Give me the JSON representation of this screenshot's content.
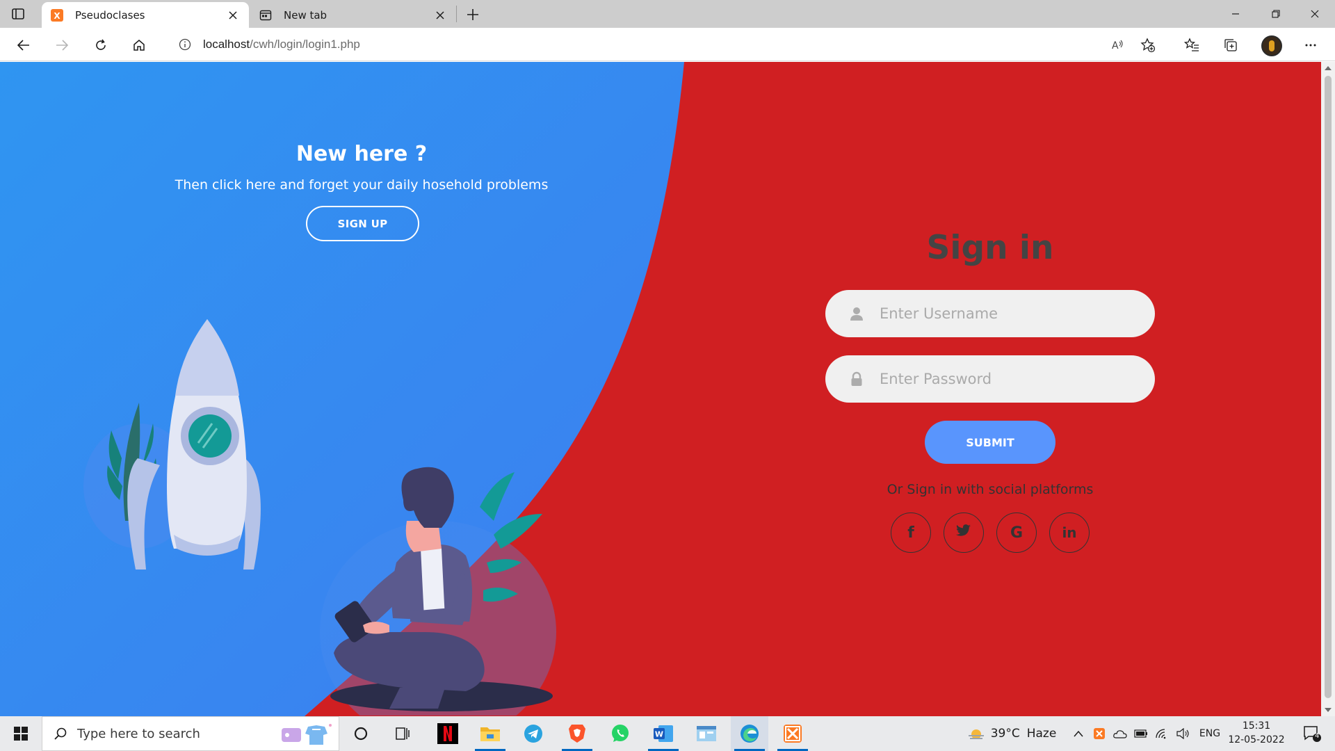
{
  "browser": {
    "tabs": [
      {
        "title": "Pseudoclases",
        "icon": "xampp-icon",
        "active": true
      },
      {
        "title": "New tab",
        "icon": "new-tab-page-icon",
        "active": false
      }
    ],
    "address": {
      "host": "localhost",
      "path": "/cwh/login/login1.php"
    }
  },
  "left_panel": {
    "heading": "New here ?",
    "text": "Then click here and forget your daily hosehold problems",
    "button": "SIGN UP"
  },
  "signin": {
    "title": "Sign in",
    "username_placeholder": "Enter Username",
    "password_placeholder": "Enter Password",
    "submit": "SUBMIT",
    "social_text": "Or Sign in with social platforms",
    "social": [
      {
        "name": "facebook",
        "glyph": "f"
      },
      {
        "name": "twitter",
        "glyph": ""
      },
      {
        "name": "google",
        "glyph": "G"
      },
      {
        "name": "linkedin",
        "glyph": "in"
      }
    ]
  },
  "taskbar": {
    "search_placeholder": "Type here to search",
    "weather": {
      "temp": "39°C",
      "condition": "Haze"
    },
    "language": "ENG",
    "time": "15:31",
    "date": "12-05-2022",
    "notifications": "4"
  },
  "colors": {
    "blue": "#3d8af7",
    "red": "#d01f22",
    "submit": "#5995fd"
  }
}
